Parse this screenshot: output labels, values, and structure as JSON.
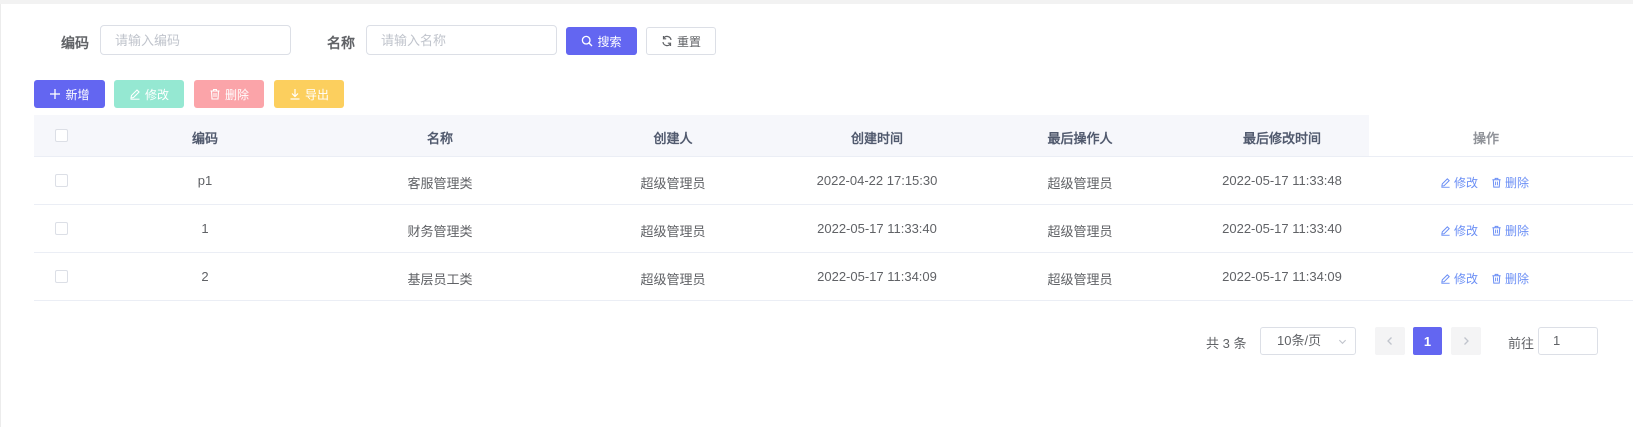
{
  "search": {
    "code_label": "编码",
    "code_placeholder": "请输入编码",
    "name_label": "名称",
    "name_placeholder": "请输入名称",
    "search_button": "搜索",
    "reset_button": "重置"
  },
  "toolbar": {
    "add": "新增",
    "edit": "修改",
    "delete": "删除",
    "export": "导出"
  },
  "table": {
    "columns": [
      "编码",
      "名称",
      "创建人",
      "创建时间",
      "最后操作人",
      "最后修改时间",
      "操作"
    ],
    "rows": [
      {
        "code": "p1",
        "name": "客服管理类",
        "creator": "超级管理员",
        "created_at": "2022-04-22 17:15:30",
        "last_operator": "超级管理员",
        "modified_at": "2022-05-17 11:33:48",
        "edit": "修改",
        "delete": "删除"
      },
      {
        "code": "1",
        "name": "财务管理类",
        "creator": "超级管理员",
        "created_at": "2022-05-17 11:33:40",
        "last_operator": "超级管理员",
        "modified_at": "2022-05-17 11:33:40",
        "edit": "修改",
        "delete": "删除"
      },
      {
        "code": "2",
        "name": "基层员工类",
        "creator": "超级管理员",
        "created_at": "2022-05-17 11:34:09",
        "last_operator": "超级管理员",
        "modified_at": "2022-05-17 11:34:09",
        "edit": "修改",
        "delete": "删除"
      }
    ]
  },
  "pagination": {
    "total": "共 3 条",
    "page_size": "10条/页",
    "current_page": "1",
    "goto_label": "前往",
    "goto_value": "1"
  },
  "colors": {
    "primary": "#6366f1",
    "edit": "#95e8d2",
    "delete": "#fba4a9",
    "export": "#fccf5e",
    "link": "#6b8ff5"
  },
  "icons": {
    "search_button": "search-icon",
    "reset_button": "refresh-icon",
    "add_button": "plus-icon",
    "edit_button": "edit-icon",
    "delete_button": "trash-icon",
    "export_button": "download-icon",
    "pagination_prev": "chevron-left-icon",
    "pagination_next": "chevron-right-icon",
    "page_size_select": "chevron-down-icon"
  }
}
